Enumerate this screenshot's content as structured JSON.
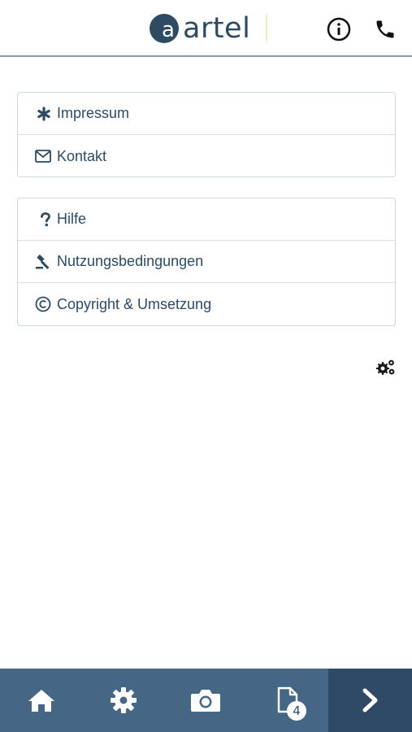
{
  "header": {
    "logo_text": "artel",
    "logo_letter": "a",
    "info_icon": "info-circle-icon",
    "phone_icon": "phone-icon"
  },
  "menu_group_1": [
    {
      "label": "Impressum",
      "icon": "asterisk-icon"
    },
    {
      "label": "Kontakt",
      "icon": "envelope-icon"
    }
  ],
  "menu_group_2": [
    {
      "label": "Hilfe",
      "icon": "question-icon"
    },
    {
      "label": "Nutzungsbedingungen",
      "icon": "gavel-icon"
    },
    {
      "label": "Copyright & Umsetzung",
      "icon": "copyright-icon"
    }
  ],
  "settings_icon": "gears-icon",
  "tabbar": {
    "items": [
      {
        "icon": "home-icon"
      },
      {
        "icon": "gear-icon"
      },
      {
        "icon": "camera-icon"
      },
      {
        "icon": "document-icon",
        "badge": "4"
      },
      {
        "icon": "chevron-right-icon"
      }
    ]
  },
  "colors": {
    "primary": "#2f4a63",
    "tabbar": "#456684",
    "tabbar_active": "#2e4a66",
    "border": "#cfd6dc"
  }
}
